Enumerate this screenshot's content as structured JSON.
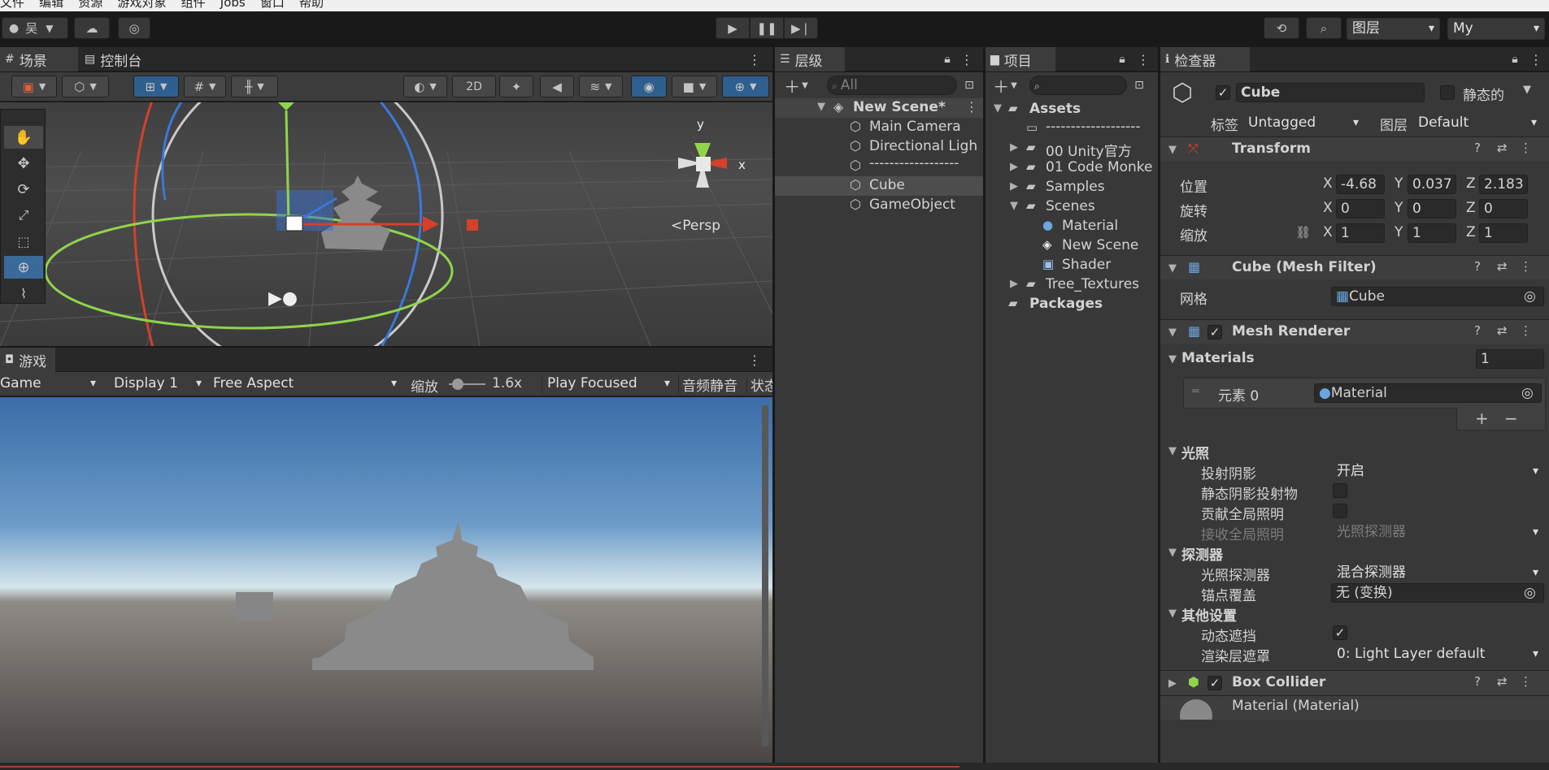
{
  "menu": [
    "文件",
    "编辑",
    "资源",
    "游戏对象",
    "组件",
    "Jobs",
    "窗口",
    "帮助"
  ],
  "toolbar": {
    "account": "吴",
    "layers_label": "图层",
    "layout_label": "My"
  },
  "scene_tabs": {
    "scene": "场景",
    "console": "控制台"
  },
  "scene_view": {
    "twod": "2D",
    "persp": "<Persp",
    "gizmo_y": "y",
    "gizmo_x": "x"
  },
  "game": {
    "tab": "游戏",
    "display_mode": "Game",
    "display": "Display 1",
    "aspect": "Free Aspect",
    "scale_label": "缩放",
    "scale_value": "1.6x",
    "play_mode": "Play Focused",
    "mute": "音频静音",
    "stats": "状态"
  },
  "hierarchy": {
    "tab": "层级",
    "search_placeholder": "All",
    "scene_name": "New Scene*",
    "items": [
      "Main Camera",
      "Directional Ligh",
      "------------------",
      "Cube",
      "GameObject"
    ]
  },
  "project": {
    "tab": "项目",
    "assets": "Assets",
    "items": [
      "-------------------",
      "00 Unity官方",
      "01 Code Monke",
      "Samples",
      "Scenes",
      "Material",
      "New Scene",
      "Shader",
      "Tree_Textures"
    ],
    "packages": "Packages"
  },
  "inspector": {
    "tab": "检查器",
    "object_name": "Cube",
    "static_label": "静态的",
    "tag_label": "标签",
    "tag_value": "Untagged",
    "layer_label": "图层",
    "layer_value": "Default",
    "transform": {
      "title": "Transform",
      "position_label": "位置",
      "rotation_label": "旋转",
      "scale_label": "缩放",
      "position": [
        "-4.68",
        "0.037",
        "2.183"
      ],
      "rotation": [
        "0",
        "0",
        "0"
      ],
      "scale": [
        "1",
        "1",
        "1"
      ],
      "axis_x": "X",
      "axis_y": "Y",
      "axis_z": "Z"
    },
    "mesh_filter": {
      "title": "Cube (Mesh Filter)",
      "mesh_label": "网格",
      "mesh_value": "Cube"
    },
    "mesh_renderer": {
      "title": "Mesh Renderer",
      "materials_label": "Materials",
      "materials_count": "1",
      "element_label": "元素 0",
      "element_value": "Material",
      "plus": "+",
      "minus": "−",
      "lighting_label": "光照",
      "cast_shadows_label": "投射阴影",
      "cast_shadows_value": "开启",
      "static_shadow_label": "静态阴影投射物",
      "contribute_gi_label": "贡献全局照明",
      "receive_gi_label": "接收全局照明",
      "receive_gi_value": "光照探测器",
      "probes_label": "探测器",
      "light_probes_label": "光照探测器",
      "light_probes_value": "混合探测器",
      "anchor_label": "锚点覆盖",
      "anchor_value": "无 (变换)",
      "other_label": "其他设置",
      "dynamic_occlusion_label": "动态遮挡",
      "rendering_layer_label": "渲染层遮罩",
      "rendering_layer_value": "0: Light Layer default"
    },
    "box_collider": {
      "title": "Box Collider"
    },
    "material_footer": "Material (Material)"
  },
  "colors": {
    "accent": "#3a79bb",
    "panel": "#383838",
    "dark": "#282828",
    "error": "#e04a3a"
  }
}
